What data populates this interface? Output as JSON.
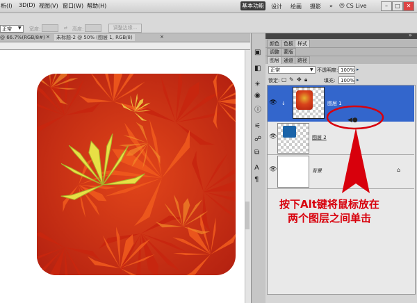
{
  "menubar": {
    "items": [
      "析(I)",
      "3D(D)",
      "视图(V)",
      "窗口(W)",
      "帮助(H)"
    ],
    "workspace_active": "基本功能",
    "workspace_items": [
      "设计",
      "绘画",
      "摄影"
    ],
    "more": "»",
    "cs_live": "CS Live",
    "win_controls": [
      "–",
      "□",
      "✕"
    ]
  },
  "options": {
    "mode_value": "正常",
    "width_label": "宽度:",
    "height_label": "高度:",
    "refine_edge": "调整边缘..."
  },
  "doc_tabs": [
    "@ 66.7%(RGB/8#)",
    "未标题-2 @ 50% (图层 1, RGB/8)"
  ],
  "panels": {
    "top_tabs": [
      "颜色",
      "色板",
      "样式"
    ],
    "mid_tabs": [
      "调整",
      "蒙版"
    ],
    "layer_tabs": [
      "图层",
      "通道",
      "路径"
    ]
  },
  "layers": {
    "blend_mode": "正常",
    "opacity_label": "不透明度:",
    "opacity_value": "100%",
    "lock_label": "锁定:",
    "fill_label": "填充:",
    "fill_value": "100%",
    "items": [
      {
        "name": "图层 1",
        "selected": true
      },
      {
        "name": "图层 2",
        "selected": false
      },
      {
        "name": "背景",
        "selected": false
      }
    ]
  },
  "annotation": {
    "line1": "按下Alt键将鼠标放在",
    "line2": "两个图层之间单击"
  },
  "colors": {
    "accent_blue": "#3366cc",
    "annotation_red": "#d8000c",
    "swatch_blue": "#1a63a8"
  }
}
